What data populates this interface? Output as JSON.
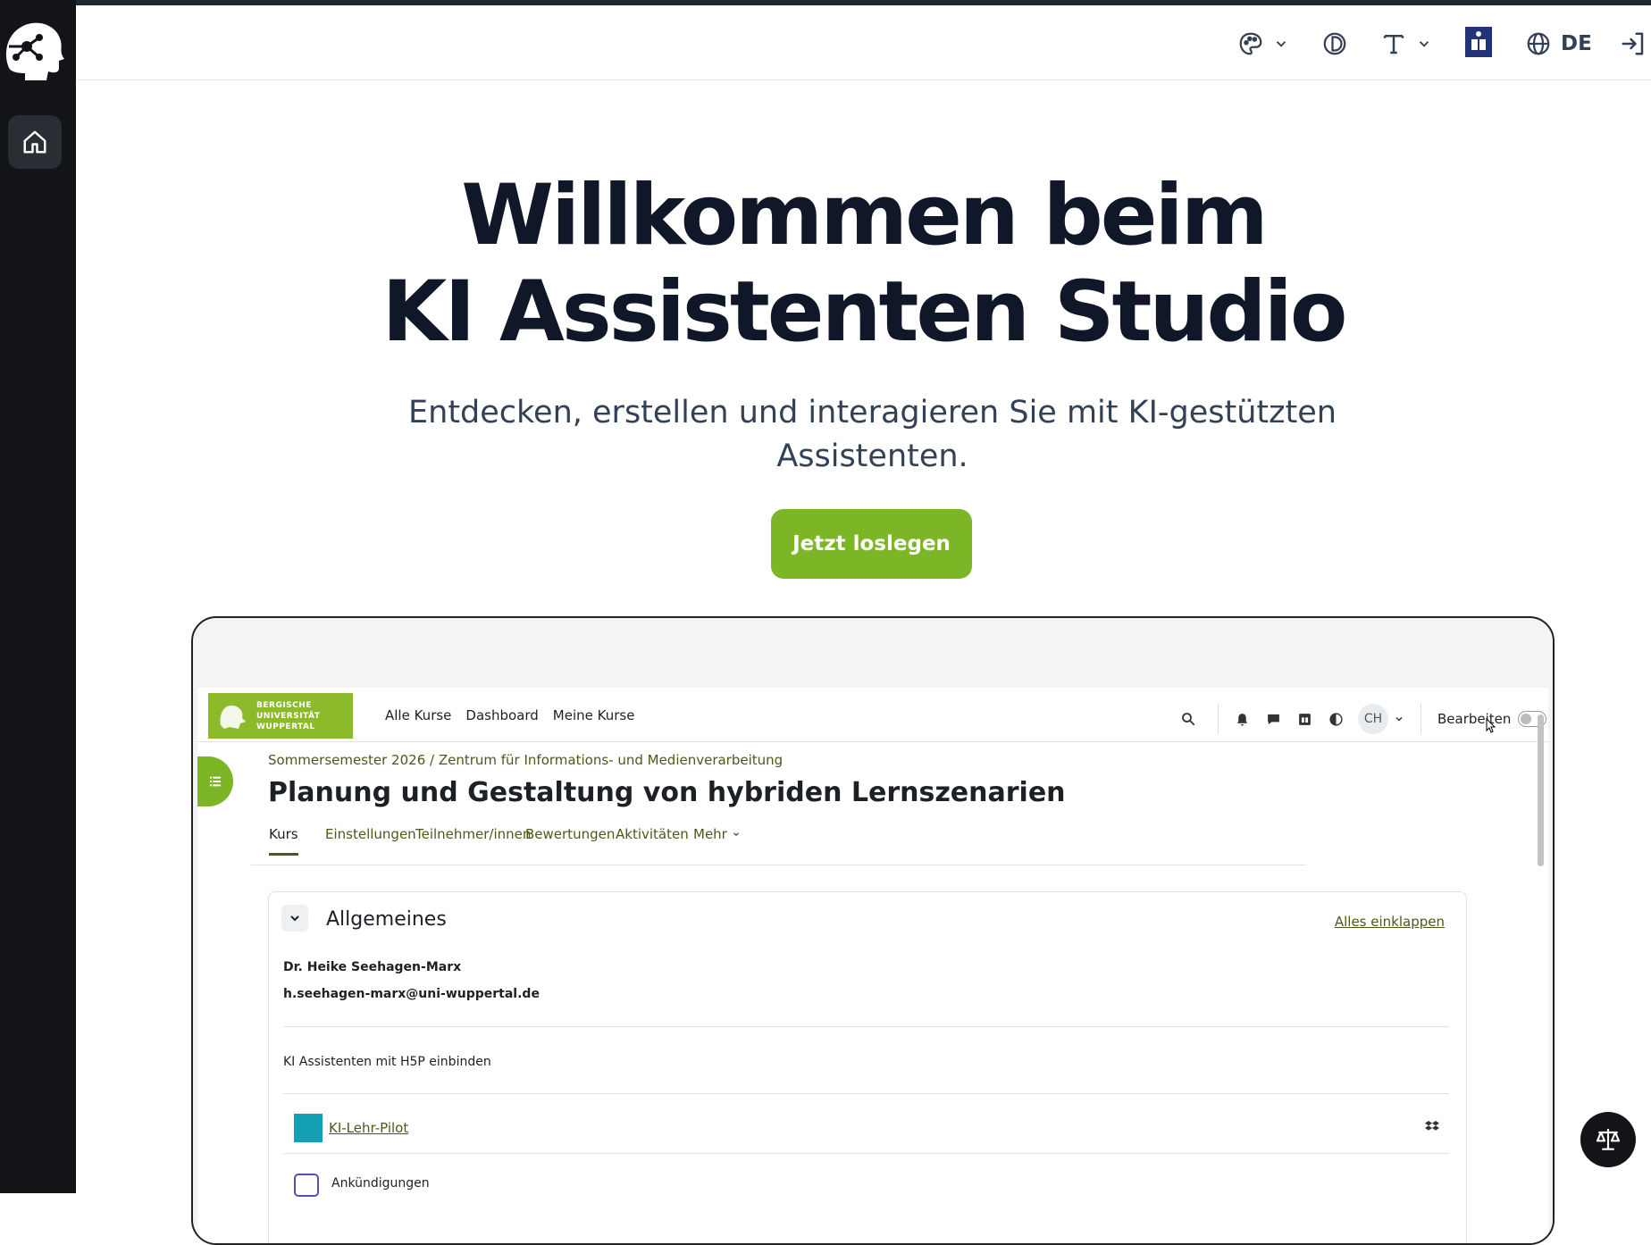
{
  "header": {
    "language": "DE"
  },
  "hero": {
    "title_line1": "Willkommen beim",
    "title_line2": "KI Assistenten Studio",
    "subtitle": "Entdecken, erstellen und interagieren Sie mit KI-gestützten Assistenten.",
    "cta_label": "Jetzt loslegen"
  },
  "preview": {
    "university_lines": [
      "BERGISCHE",
      "UNIVERSITÄT",
      "WUPPERTAL"
    ],
    "nav": [
      "Alle Kurse",
      "Dashboard",
      "Meine Kurse"
    ],
    "user_initials": "CH",
    "edit_label": "Bearbeiten",
    "breadcrumb": "Sommersemester 2026  /  Zentrum für Informations- und Medienverarbeitung",
    "course_title": "Planung und Gestaltung von hybriden Lernszenarien",
    "tabs": [
      "Kurs",
      "Einstellungen",
      "Teilnehmer/innen",
      "Bewertungen",
      "Aktivitäten",
      "Mehr"
    ],
    "section_title": "Allgemeines",
    "collapse_all": "Alles einklappen",
    "contact_name": "Dr. Heike Seehagen-Marx",
    "contact_email": "h.seehagen-marx@uni-wuppertal.de",
    "note": "KI Assistenten mit H5P einbinden",
    "activity_link": "KI-Lehr-Pilot",
    "next_item": "Ankündigungen"
  },
  "icons": {
    "logo": "brain-head-icon",
    "home": "home-icon",
    "theme": "palette-icon",
    "contrast": "contrast-icon",
    "font": "text-size-icon",
    "reader": "reader-icon",
    "language": "globe-icon",
    "login": "login-icon",
    "legal": "scales-icon"
  },
  "colors": {
    "accent_green": "#7cb627",
    "rail_dark": "#131417",
    "title_navy": "#0f1729"
  }
}
